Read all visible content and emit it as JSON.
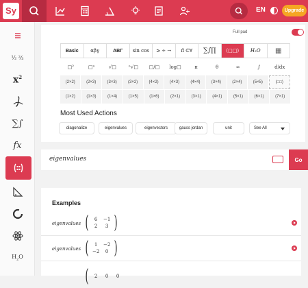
{
  "app": {
    "logo": "Sy",
    "lang": "EN",
    "upgrade": "Upgrade",
    "accent": "#dc3b51"
  },
  "topnav": [
    "search-icon",
    "chart-icon",
    "calculator-icon",
    "geometry-icon",
    "bulb-icon",
    "notebook-icon",
    "group-icon"
  ],
  "sidebar": [
    "menu-icon",
    "fractions-icon",
    "exponent-icon",
    "integral-curve-icon",
    "sigma-icon",
    "function-icon",
    "matrix-icon",
    "triangle-icon",
    "chem-ring-icon",
    "atom-icon",
    "h2o-icon"
  ],
  "pad": {
    "full_pad": "Full pad",
    "tabs": [
      "Basic",
      "αβγ",
      "ABΓ",
      "sin cos",
      "≥ ÷ →",
      "π̄ ℂ∀",
      "∑∫∏",
      "(□□)",
      "H₂O",
      "▦"
    ],
    "symbols": [
      "□²",
      "□ˣ",
      "√□",
      "ⁿ√□",
      "□/□",
      "log□",
      "π",
      "θ",
      "∞",
      "∫",
      "d/dx"
    ],
    "row1": [
      "(2×2)",
      "(2×3)",
      "(3×3)",
      "(3×2)",
      "(4×2)",
      "(4×3)",
      "(4×4)",
      "(3×4)",
      "(2×4)",
      "(5×5)",
      "(□□)"
    ],
    "row2": [
      "(1×2)",
      "(1×3)",
      "(1×4)",
      "(1×5)",
      "(1×6)",
      "(2×1)",
      "(3×1)",
      "(4×1)",
      "(5×1)",
      "(6×1)",
      "(7×1)"
    ]
  },
  "most_used": {
    "title": "Most Used Actions",
    "chips": [
      "diagonalize",
      "eigenvalues",
      "eigenvectors",
      "gauss jordan",
      "unit"
    ],
    "see_all": "See All"
  },
  "input": {
    "value": "eigenvalues",
    "go": "Go"
  },
  "examples": {
    "title": "Examples",
    "items": [
      {
        "fn": "eigenvalues",
        "m": [
          "6",
          "−1",
          "2",
          "3"
        ]
      },
      {
        "fn": "eigenvalues",
        "m": [
          "1",
          "−2",
          "−2",
          "0"
        ]
      },
      {
        "fn": "",
        "m": [
          "2",
          "0",
          "0",
          ""
        ]
      }
    ]
  }
}
